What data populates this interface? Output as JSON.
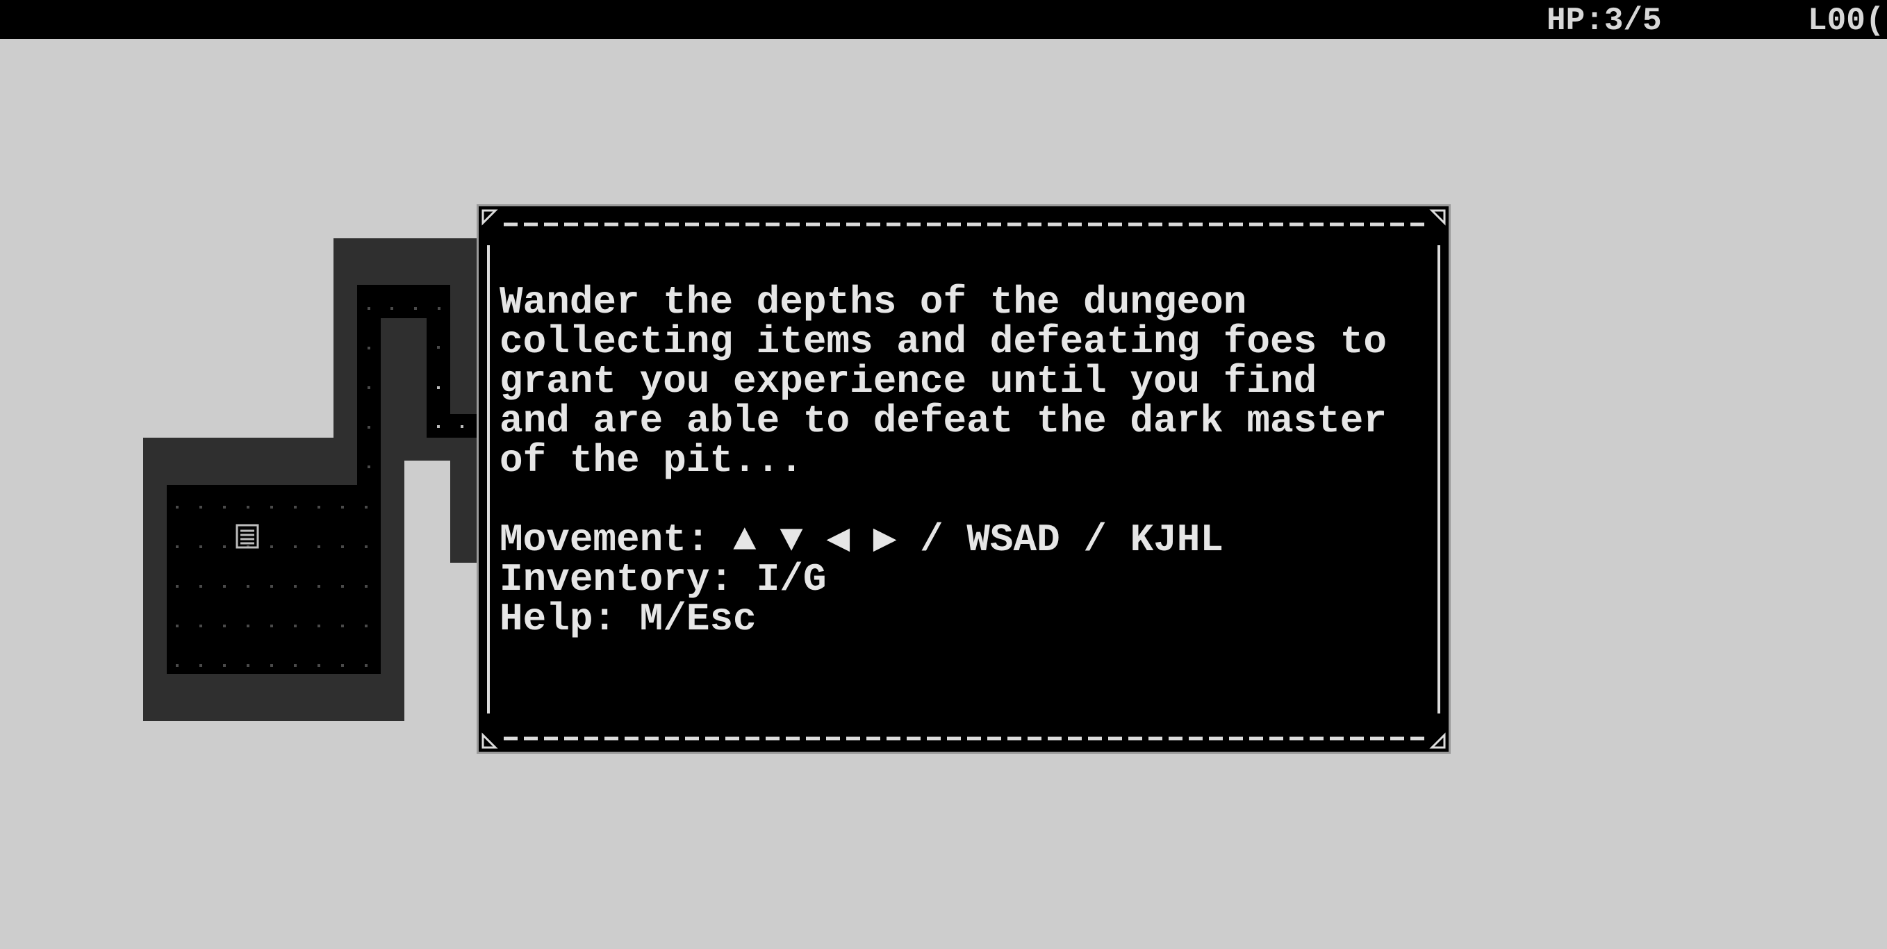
{
  "status": {
    "hp": "HP:3/5",
    "level": "L00("
  },
  "dialog": {
    "intro_lines": [
      "Wander the depths of the dungeon",
      "collecting items and defeating foes to",
      "grant you experience until you find",
      "and are able to defeat the dark master",
      "of the pit..."
    ],
    "controls": {
      "movement": "Movement: ▲ ▼ ◀ ▶ / WSAD / KJHL",
      "inventory": "Inventory: I/G",
      "help": "Help: M/Esc"
    }
  },
  "map": {
    "item_icon": "scroll-icon"
  },
  "colors": {
    "background": "#cdcdcd",
    "wall": "#2f2f2f",
    "floor": "#000000",
    "text": "#e6e6e6"
  }
}
